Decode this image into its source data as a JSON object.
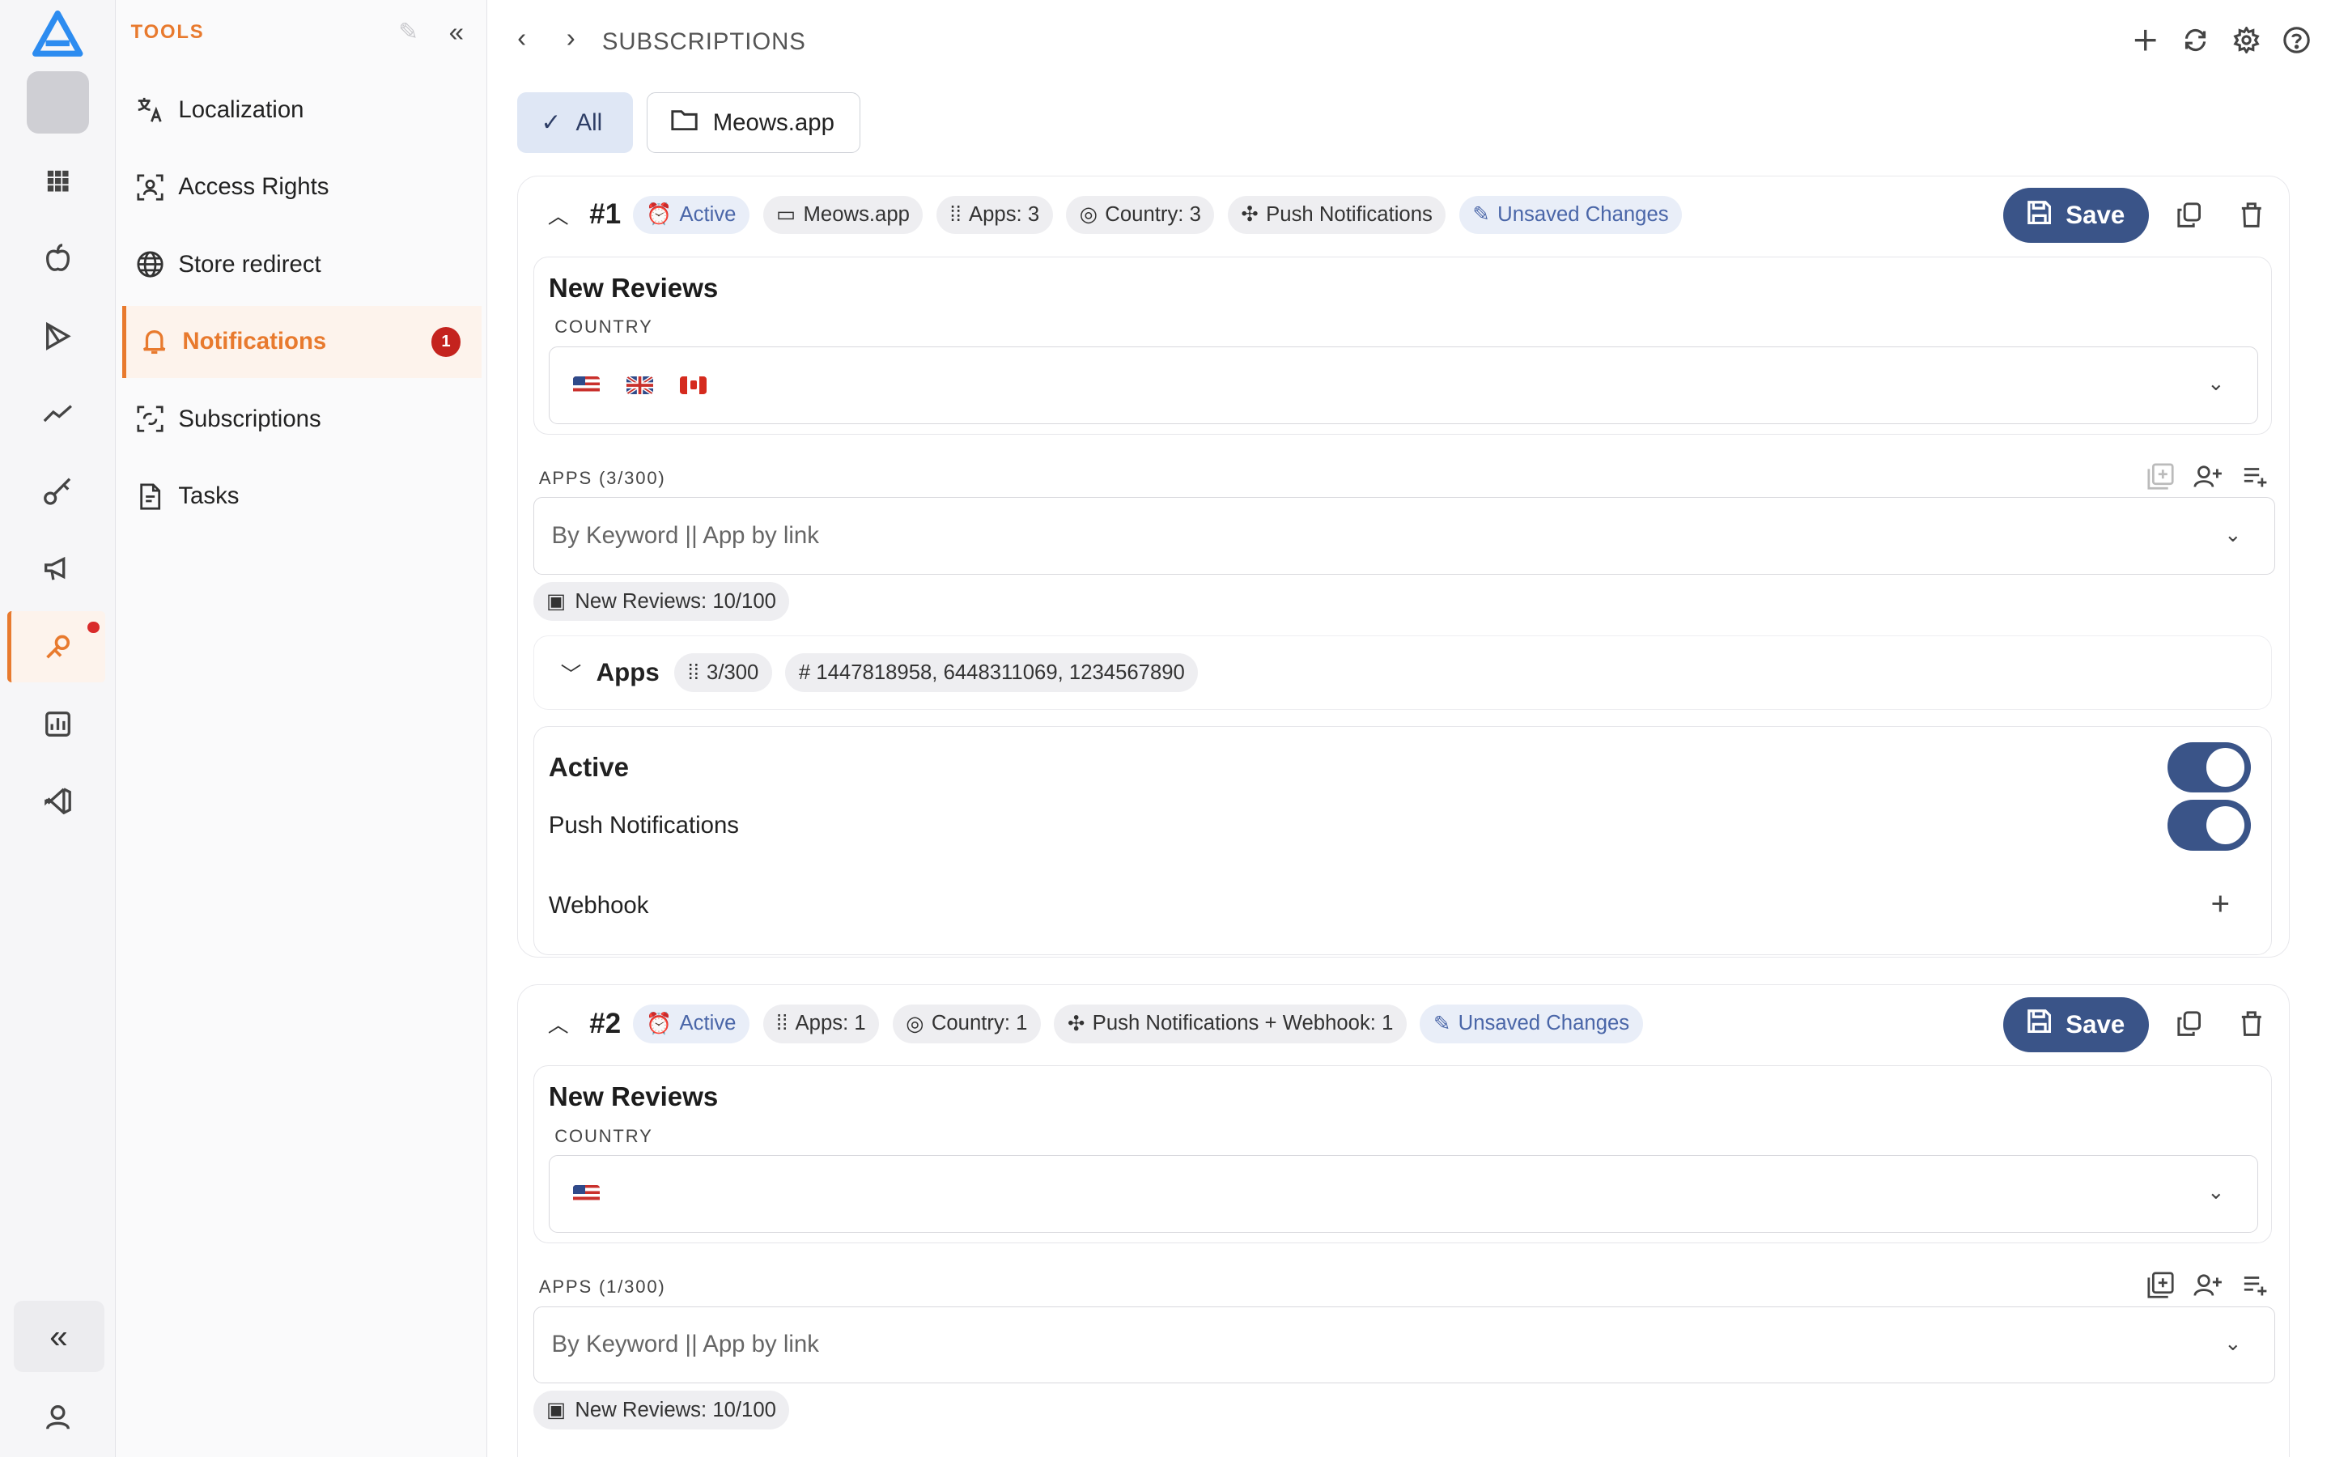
{
  "sidebar": {
    "header": "TOOLS",
    "items": [
      {
        "label": "Localization",
        "icon": "translate-icon"
      },
      {
        "label": "Access Rights",
        "icon": "access-icon"
      },
      {
        "label": "Store redirect",
        "icon": "globe-icon"
      },
      {
        "label": "Notifications",
        "icon": "bell-icon",
        "badge": "1"
      },
      {
        "label": "Subscriptions",
        "icon": "subscriptions-icon"
      },
      {
        "label": "Tasks",
        "icon": "tasks-icon"
      }
    ]
  },
  "header": {
    "breadcrumb": "SUBSCRIPTIONS"
  },
  "filters": {
    "all": "All",
    "app": "Meows.app"
  },
  "subs": [
    {
      "num": "#1",
      "chips": {
        "active": "Active",
        "app": "Meows.app",
        "apps": "Apps: 3",
        "country": "Country: 3",
        "push": "Push Notifications",
        "unsaved": "Unsaved Changes"
      },
      "save": "Save",
      "section_title": "New Reviews",
      "country_label": "COUNTRY",
      "apps_label": "APPS (3/300)",
      "search_placeholder": "By Keyword || App by link",
      "reviews_chip": "New Reviews: 10/100",
      "apps_row": {
        "title": "Apps",
        "count": "3/300",
        "ids": "# 1447818958, 6448311069, 1234567890"
      },
      "toggles": {
        "active": "Active",
        "push": "Push Notifications",
        "webhook": "Webhook"
      }
    },
    {
      "num": "#2",
      "chips": {
        "active": "Active",
        "apps": "Apps: 1",
        "country": "Country: 1",
        "push": "Push Notifications + Webhook: 1",
        "unsaved": "Unsaved Changes"
      },
      "save": "Save",
      "section_title": "New Reviews",
      "country_label": "COUNTRY",
      "apps_label": "APPS (1/300)",
      "search_placeholder": "By Keyword || App by link",
      "reviews_chip": "New Reviews: 10/100"
    }
  ],
  "colors": {
    "accent": "#e87a2e",
    "primary": "#3a5488",
    "badge": "#c4231e"
  }
}
